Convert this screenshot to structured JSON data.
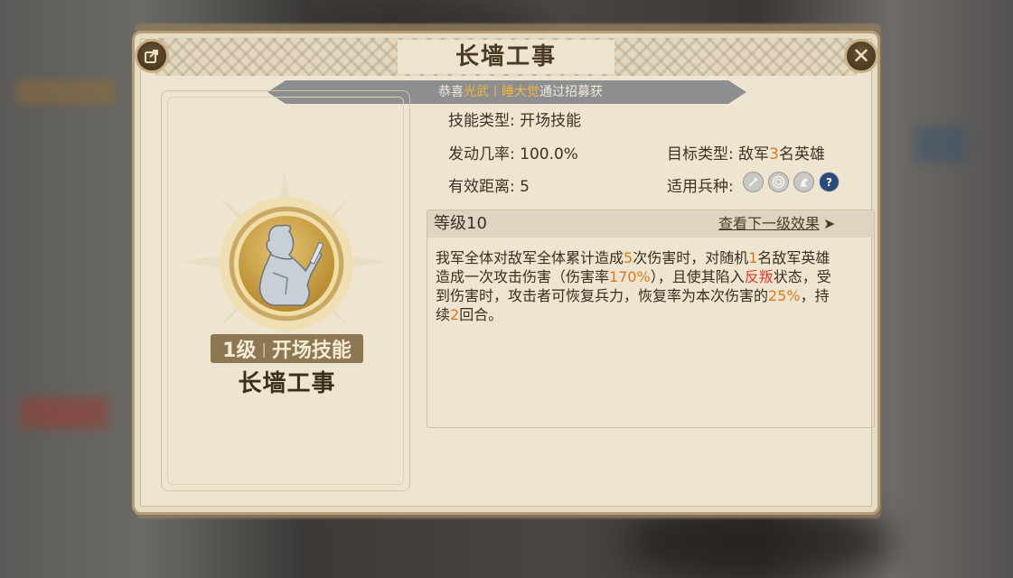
{
  "window": {
    "title": "长墙工事"
  },
  "ribbon": {
    "prefix": "恭喜",
    "name1": "光武",
    "sep": "丨",
    "name2": "睡大觉",
    "suffix": "通过招募获"
  },
  "skill_card": {
    "level_prefix": "1级",
    "level_sep": "|",
    "category": "开场技能",
    "name": "长墙工事"
  },
  "details": {
    "skill_type_label": "技能类型:",
    "skill_type_value": "开场技能",
    "trigger_rate_label": "发动几率:",
    "trigger_rate_value": "100.0%",
    "target_type_label": "目标类型:",
    "target_type_pre": "敌军",
    "target_type_num": "3",
    "target_type_post": "名英雄",
    "range_label": "有效距离:",
    "range_value": "5",
    "troop_label": "适用兵种:",
    "troop_icons": [
      "sword-icon",
      "bow-target-icon",
      "horse-icon",
      "question-icon"
    ]
  },
  "level_section": {
    "level_label": "等级10",
    "next_link": "查看下一级效果",
    "next_arrow": "➤"
  },
  "description": {
    "p1": "我军全体对敌军全体累计造成",
    "n1": "5",
    "p2": "次伤害时，对随机",
    "n2": "1",
    "p3": "名敌军英雄造成一次攻击伤害（伤害率",
    "n3": "170%",
    "p4": "），且使其陷入",
    "n4": "反叛",
    "p5": "状态，受到伤害时，攻击者可恢复兵力，恢复率为本次伤害的",
    "n5": "25%",
    "p6": "，持续",
    "n6": "2",
    "p7": "回合。"
  },
  "buttons": {
    "close": "✕",
    "share": "⇪"
  },
  "colors": {
    "accent_orange": "#e0791d",
    "accent_red": "#e23b2a",
    "panel_bg": "#ede5d0"
  }
}
